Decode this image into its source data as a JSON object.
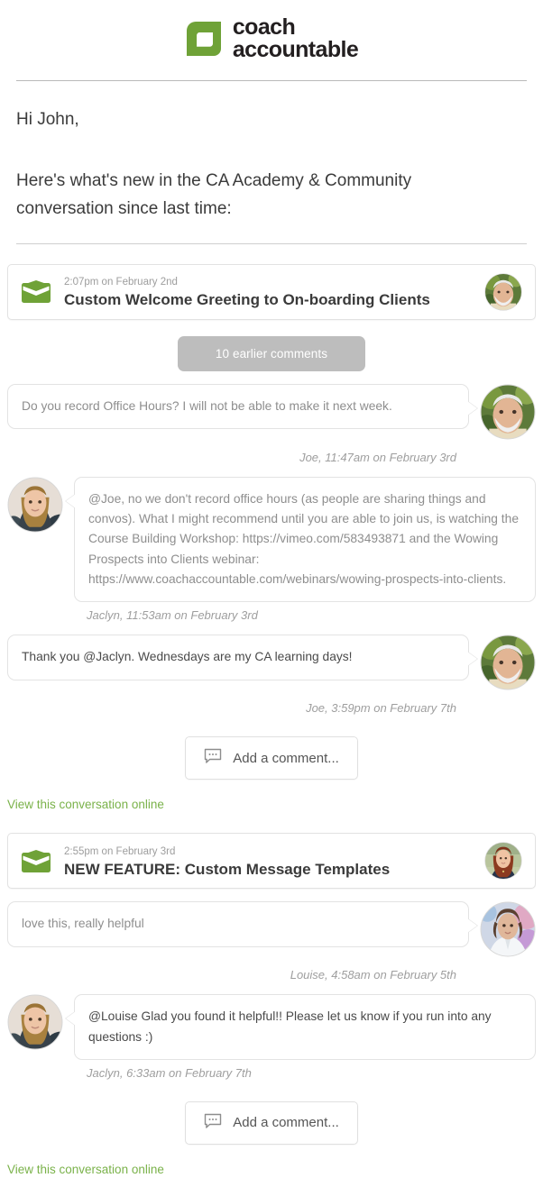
{
  "brand": {
    "logo_line1": "coach",
    "logo_line2": "accountable",
    "logo_mark_icon": "leaf-mark-icon",
    "green": "#6fa237",
    "link_green": "#7ab24a"
  },
  "intro": {
    "greeting": "Hi John,",
    "lead": "Here's what's new in the CA Academy & Community conversation since last time:"
  },
  "conversations": [
    {
      "icon": "envelope-icon",
      "time": "2:07pm on February 2nd",
      "title": "Custom Welcome Greeting to On-boarding Clients",
      "avatar_name": "joe-avatar",
      "earlier_comments_label": "10 earlier comments",
      "comments": [
        {
          "side": "right",
          "text": "Do you record Office Hours? I will not be able to make it next week.",
          "byline": "Joe, 11:47am on February 3rd",
          "avatar_name": "joe-avatar",
          "muted": true
        },
        {
          "side": "left",
          "text": "@Joe, no we don't record office hours (as people are sharing things and convos).  What I might recommend until you are able to join us, is watching the Course Building Workshop: https://vimeo.com/583493871 and the Wowing Prospects into Clients webinar: https://www.coachaccountable.com/webinars/wowing-prospects-into-clients.",
          "byline": "Jaclyn, 11:53am on February 3rd",
          "avatar_name": "jaclyn-avatar",
          "muted": true
        },
        {
          "side": "right",
          "text": "Thank you @Jaclyn. Wednesdays are my CA learning days!",
          "byline": "Joe, 3:59pm on February 7th",
          "avatar_name": "joe-avatar",
          "muted": false
        }
      ],
      "add_comment_label": "Add a comment...",
      "add_comment_icon": "comment-bubble-icon",
      "view_online_label": "View this conversation online"
    },
    {
      "icon": "envelope-icon",
      "time": "2:55pm on February 3rd",
      "title": "NEW FEATURE: Custom Message Templates",
      "avatar_name": "redhead-avatar",
      "earlier_comments_label": null,
      "comments": [
        {
          "side": "right",
          "text": "love this, really helpful",
          "byline": "Louise, 4:58am on February 5th",
          "avatar_name": "louise-avatar",
          "muted": true
        },
        {
          "side": "left",
          "text": "@Louise Glad you found it helpful!! Please let us know if you run into any questions :)",
          "byline": "Jaclyn, 6:33am on February 7th",
          "avatar_name": "jaclyn-avatar",
          "muted": false
        }
      ],
      "add_comment_label": "Add a comment...",
      "add_comment_icon": "comment-bubble-icon",
      "view_online_label": "View this conversation online"
    }
  ]
}
